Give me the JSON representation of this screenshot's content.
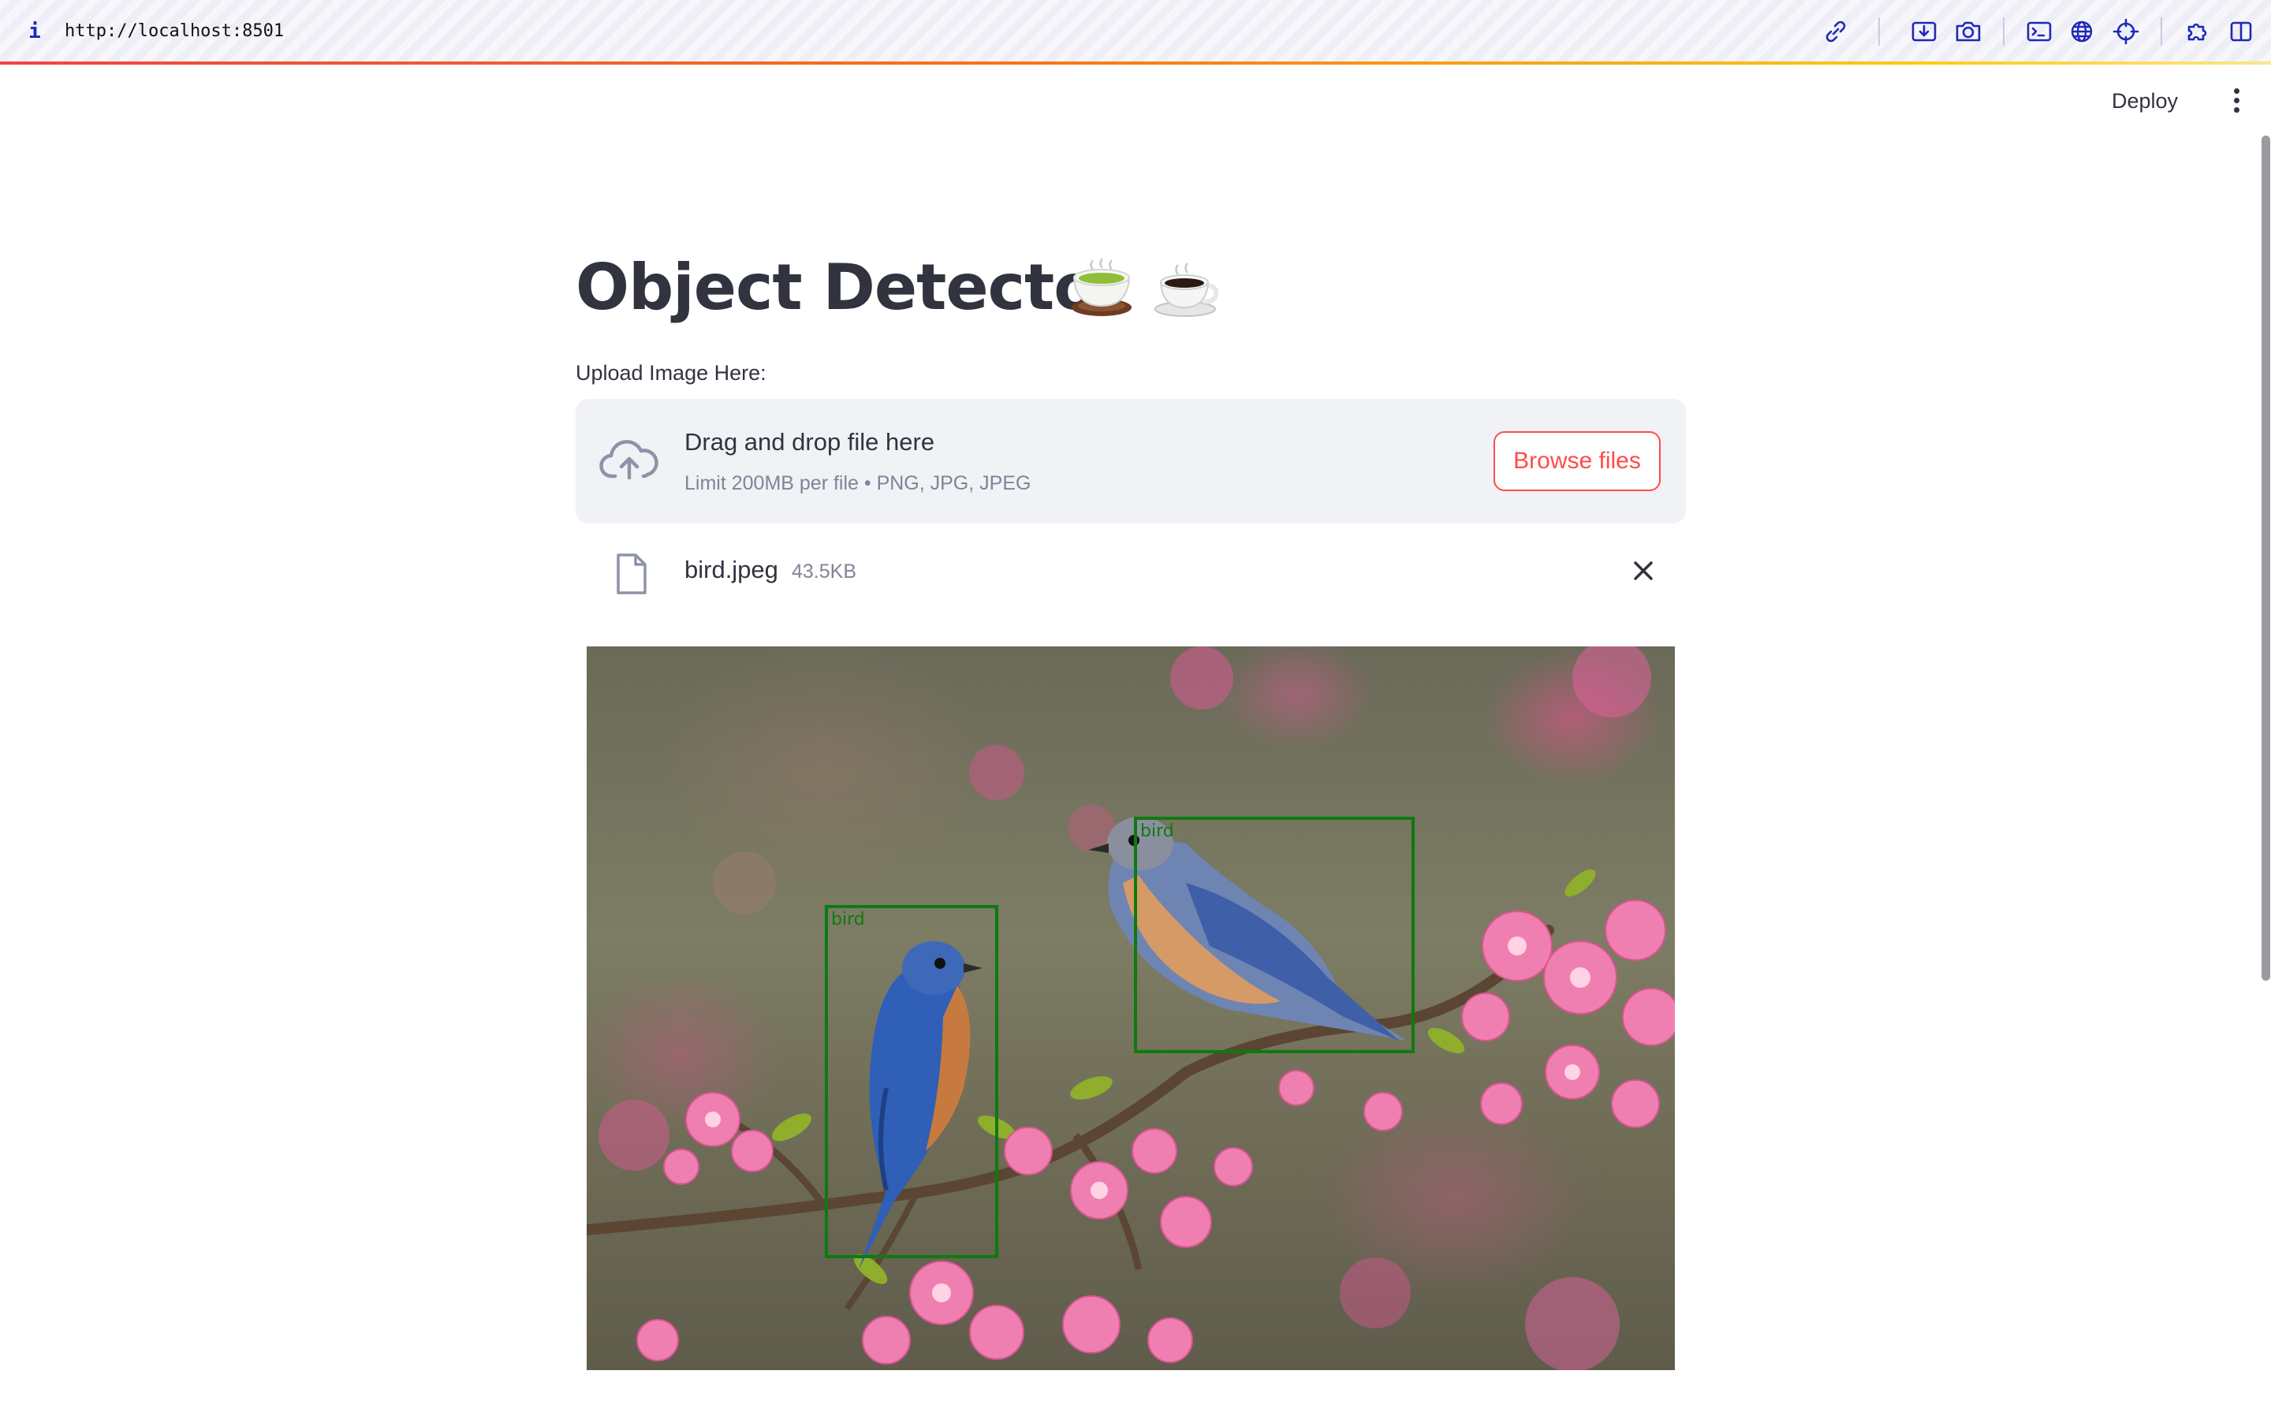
{
  "browser": {
    "url": "http://localhost:8501",
    "info_icon_glyph": "i",
    "toolbar_icons": [
      "link-icon",
      "download-icon",
      "camera-icon",
      "terminal-icon",
      "globe-icon",
      "crosshair-icon",
      "extension-icon",
      "split-view-icon"
    ],
    "accent_color": "#1d28b8"
  },
  "header": {
    "deploy_label": "Deploy",
    "menu_icon": "kebab-menu-icon"
  },
  "main": {
    "title": "Object Detector",
    "title_emojis": [
      "tea-cup-icon",
      "coffee-cup-icon"
    ]
  },
  "uploader": {
    "label": "Upload Image Here:",
    "drop_title": "Drag and drop file here",
    "drop_subtitle": "Limit 200MB per file • PNG, JPG, JPEG",
    "browse_label": "Browse files",
    "accent_color": "#ff4b4b",
    "file": {
      "name": "bird.jpeg",
      "size": "43.5KB"
    }
  },
  "result": {
    "detections": [
      {
        "label": "bird"
      },
      {
        "label": "bird"
      }
    ],
    "box_color": "#0f7a0f"
  }
}
